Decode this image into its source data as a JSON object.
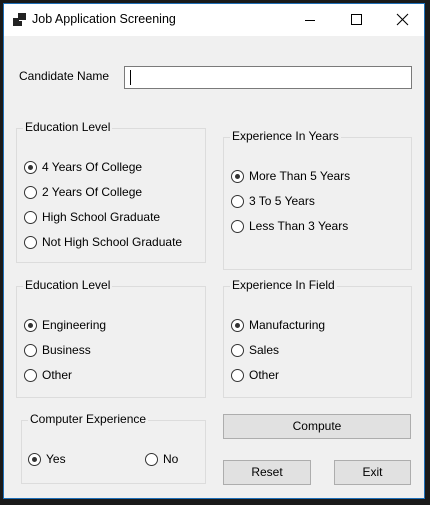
{
  "window": {
    "title": "Job Application Screening",
    "controls": [
      "minimize-icon",
      "maximize-icon",
      "close-icon"
    ]
  },
  "candidate": {
    "label": "Candidate Name",
    "value": ""
  },
  "education_level": {
    "title": "Education Level",
    "options": [
      "4 Years Of College",
      "2 Years Of College",
      "High School Graduate",
      "Not High School Graduate"
    ],
    "selected": "4 Years Of College"
  },
  "experience_years": {
    "title": "Experience In Years",
    "options": [
      "More Than 5 Years",
      "3 To 5 Years",
      "Less Than 3 Years"
    ],
    "selected": "More Than 5 Years"
  },
  "education_field": {
    "title": "Education Level",
    "options": [
      "Engineering",
      "Business",
      "Other"
    ],
    "selected": "Engineering"
  },
  "experience_field": {
    "title": "Experience In Field",
    "options": [
      "Manufacturing",
      "Sales",
      "Other"
    ],
    "selected": "Manufacturing"
  },
  "computer_experience": {
    "title": "Computer Experience",
    "options": [
      "Yes",
      "No"
    ],
    "selected": "Yes"
  },
  "buttons": {
    "compute": "Compute",
    "reset": "Reset",
    "exit": "Exit"
  }
}
